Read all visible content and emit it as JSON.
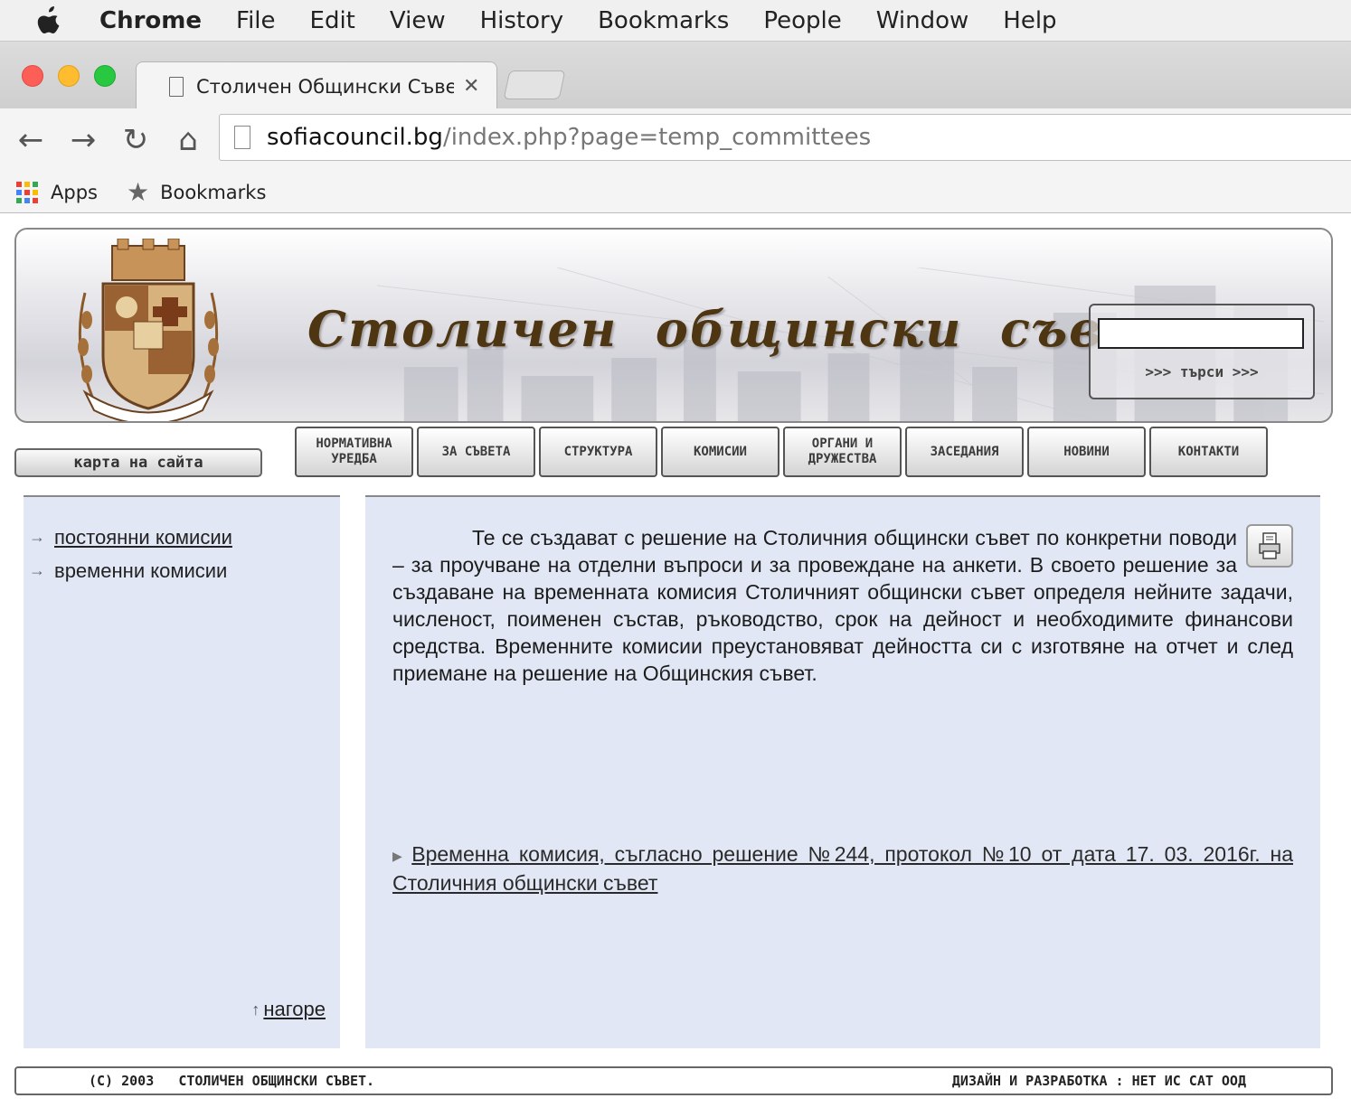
{
  "menubar": {
    "app": "Chrome",
    "items": [
      "File",
      "Edit",
      "View",
      "History",
      "Bookmarks",
      "People",
      "Window",
      "Help"
    ]
  },
  "tab": {
    "title": "Столичен Общински Съвет",
    "close": "✕"
  },
  "toolbar": {
    "url_host": "sofiacouncil.bg",
    "url_path": "/index.php?page=temp_committees"
  },
  "bookmarks": {
    "apps": "Apps",
    "bookmarks": "Bookmarks"
  },
  "site": {
    "title": "Столичен  общински  съвет",
    "search_button": ">>> търси >>>",
    "search_value": "",
    "sitemap": "карта на сайта",
    "nav": [
      "НОРМАТИВНА УРЕДБА",
      "ЗА СЪВЕТА",
      "СТРУКТУРА",
      "КОМИСИИ",
      "ОРГАНИ И ДРУЖЕСТВА",
      "ЗАСЕДАНИЯ",
      "НОВИНИ",
      "КОНТАКТИ"
    ]
  },
  "sidebar": {
    "items": [
      "постоянни комисии",
      "временни комисии"
    ],
    "to_top": "нагоре"
  },
  "main": {
    "intro": "Те се създават с решение на Столичния общински съвет по конкретни поводи – за проучване на отделни въпроси и за провеждане на анкети. В своето решение за създаване на временната комисия Столичният общински съвет определя нейните задачи, численост, поименен състав, ръководство, срок на дейност и необходимите финансови средства. Временните комисии преустановяват дейността си с изготвяне на отчет и след приемане на решение на Общинския съвет.",
    "link": "Временна комисия, съгласно решение №244, протокол №10 от дата 17. 03. 2016г. на Столичния общински съвет"
  },
  "footer": {
    "left": "(C) 2003   СТОЛИЧЕН ОБЩИНСКИ СЪВЕТ.",
    "right": "ДИЗАЙН И РАЗРАБОТКА : НЕТ ИС САТ ООД"
  },
  "colors": {
    "content_bg": "#e1e7f4",
    "title_brown": "#4e3613",
    "traffic_red": "#fd5f57",
    "traffic_yellow": "#febc2e",
    "traffic_green": "#28c840"
  }
}
